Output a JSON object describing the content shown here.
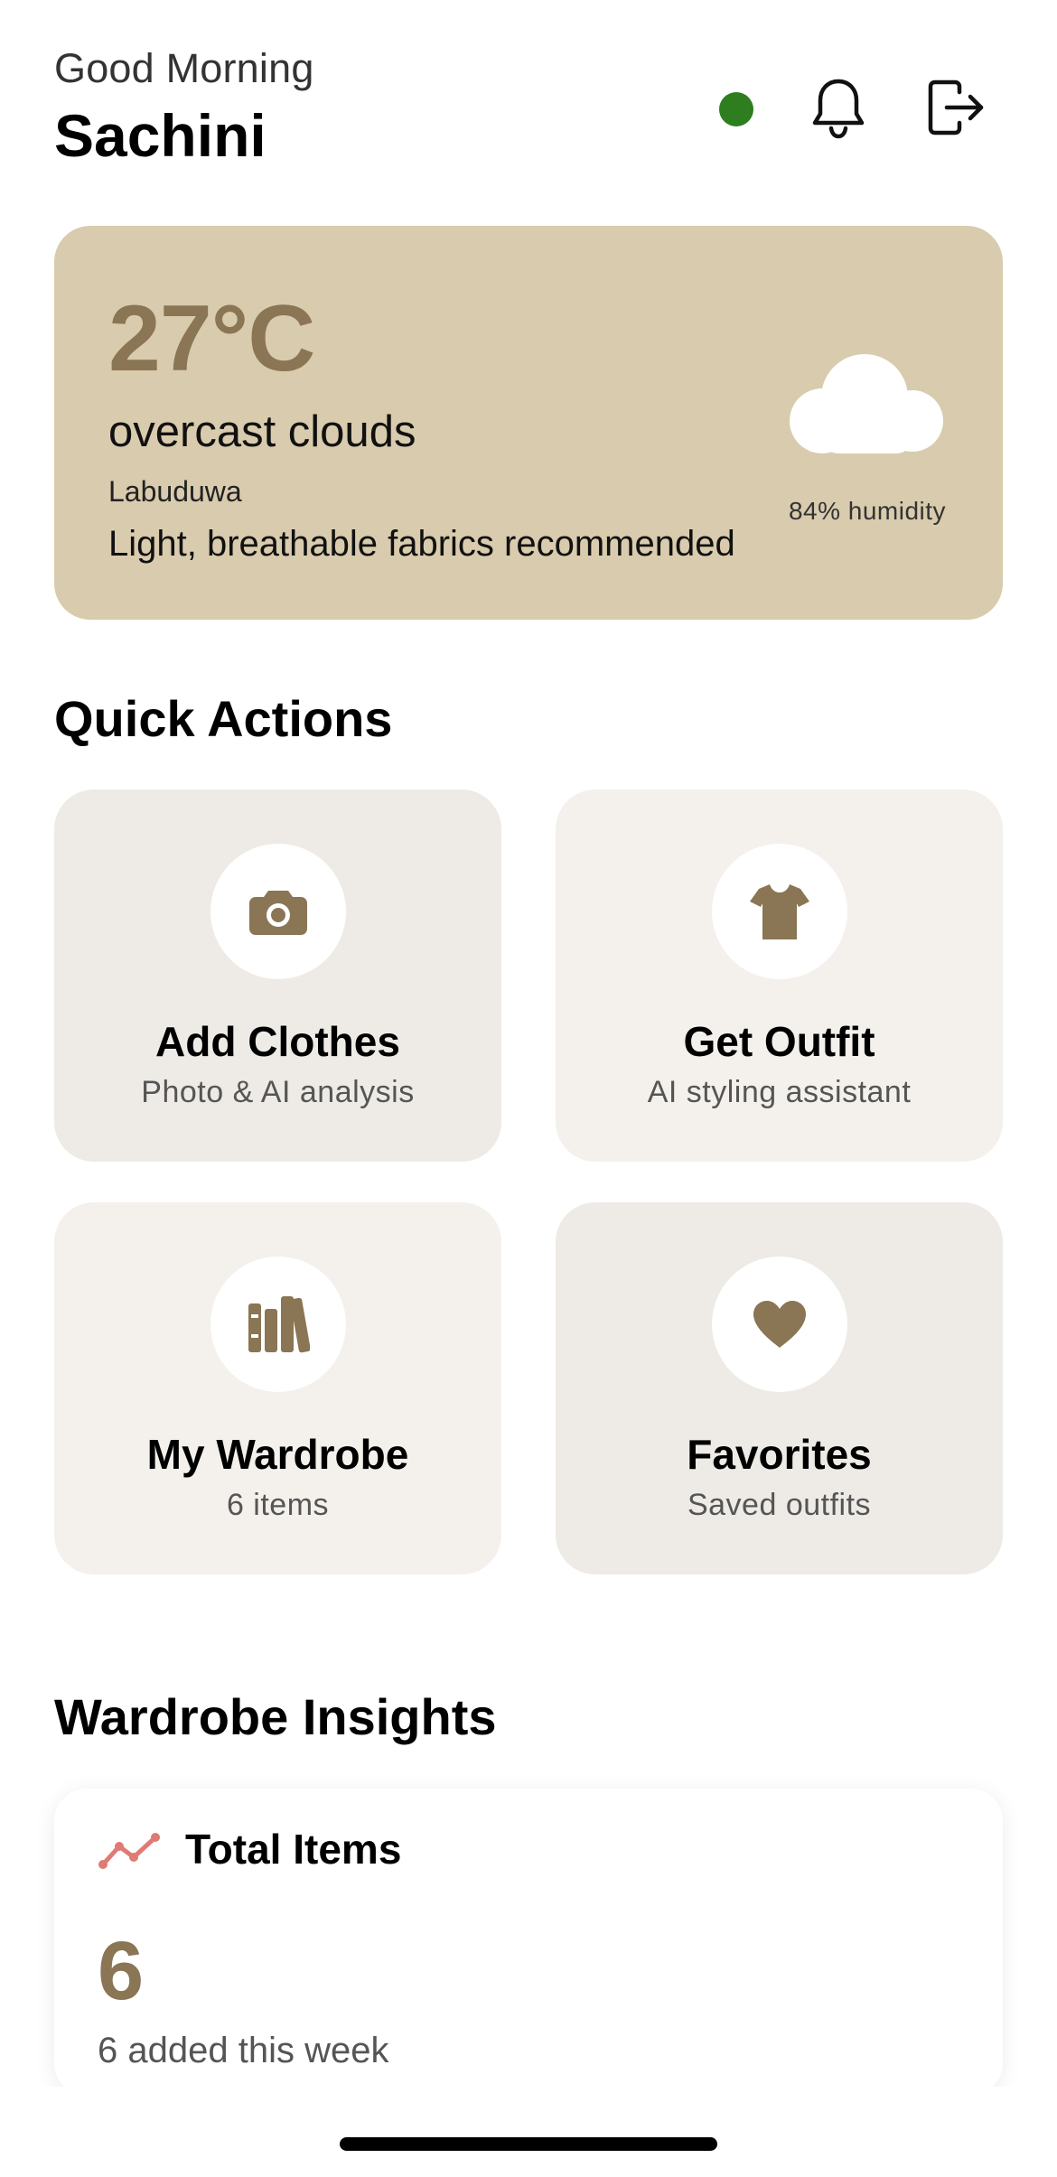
{
  "header": {
    "greeting": "Good Morning",
    "username": "Sachini",
    "status_color": "#2e7d1f",
    "icons": [
      "status-dot",
      "bell-icon",
      "logout-icon"
    ]
  },
  "weather": {
    "temperature": "27°C",
    "condition": "overcast clouds",
    "location": "Labuduwa",
    "recommendation": "Light, breathable fabrics recommended",
    "humidity": "84% humidity",
    "icon": "cloud-icon",
    "card_color": "#d9cbad",
    "accent_color": "#8a7554"
  },
  "quick_actions": {
    "title": "Quick Actions",
    "items": [
      {
        "label": "Add Clothes",
        "subtitle": "Photo & AI analysis",
        "icon": "camera-icon"
      },
      {
        "label": "Get Outfit",
        "subtitle": "AI styling assistant",
        "icon": "tshirt-icon"
      },
      {
        "label": "My Wardrobe",
        "subtitle": "6 items",
        "icon": "wardrobe-books-icon"
      },
      {
        "label": "Favorites",
        "subtitle": "Saved outfits",
        "icon": "heart-icon"
      }
    ]
  },
  "insights": {
    "title": "Wardrobe Insights",
    "total_items": {
      "label": "Total Items",
      "value": "6",
      "subtitle": "6 added this week",
      "icon": "trend-line-icon",
      "icon_color": "#e07a74"
    }
  }
}
